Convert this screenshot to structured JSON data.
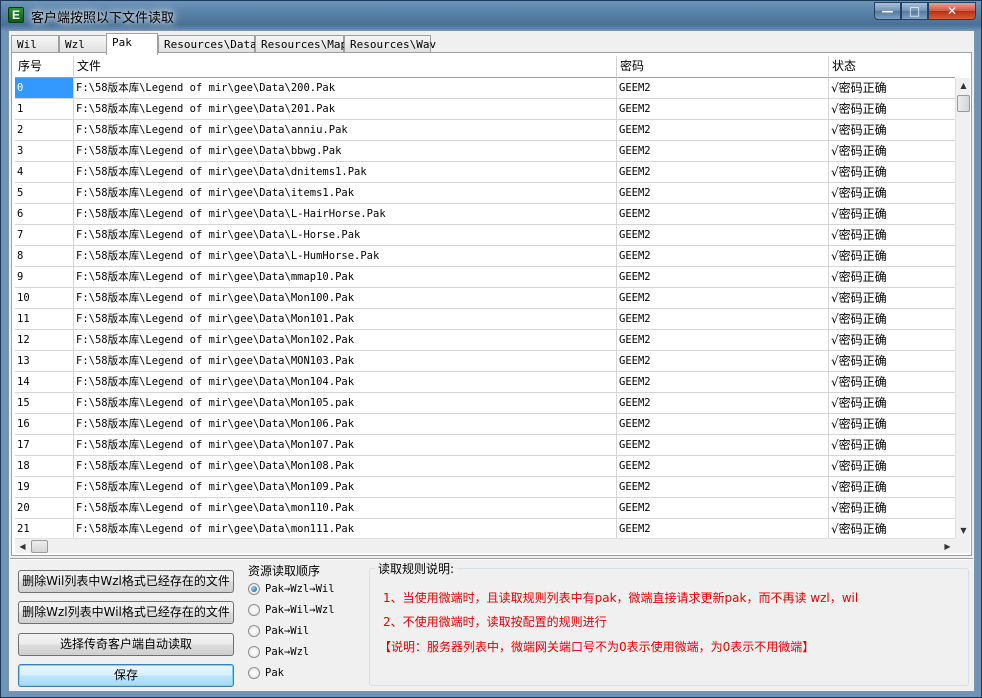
{
  "window": {
    "title": "客户端按照以下文件读取",
    "icon_letter": "E",
    "min": "—",
    "max": "□",
    "close": "✕"
  },
  "tabs": [
    {
      "label": "Wil",
      "active": false
    },
    {
      "label": "Wzl",
      "active": false
    },
    {
      "label": "Pak",
      "active": true
    },
    {
      "label": "Resources\\Data",
      "active": false
    },
    {
      "label": "Resources\\Map",
      "active": false
    },
    {
      "label": "Resources\\Wav",
      "active": false
    }
  ],
  "grid": {
    "columns": [
      "序号",
      "文件",
      "密码",
      "状态"
    ],
    "rows": [
      [
        "0",
        "F:\\58版本库\\Legend of mir\\gee\\Data\\200.Pak",
        "GEEM2",
        "√密码正确"
      ],
      [
        "1",
        "F:\\58版本库\\Legend of mir\\gee\\Data\\201.Pak",
        "GEEM2",
        "√密码正确"
      ],
      [
        "2",
        "F:\\58版本库\\Legend of mir\\gee\\Data\\anniu.Pak",
        "GEEM2",
        "√密码正确"
      ],
      [
        "3",
        "F:\\58版本库\\Legend of mir\\gee\\Data\\bbwg.Pak",
        "GEEM2",
        "√密码正确"
      ],
      [
        "4",
        "F:\\58版本库\\Legend of mir\\gee\\Data\\dnitems1.Pak",
        "GEEM2",
        "√密码正确"
      ],
      [
        "5",
        "F:\\58版本库\\Legend of mir\\gee\\Data\\items1.Pak",
        "GEEM2",
        "√密码正确"
      ],
      [
        "6",
        "F:\\58版本库\\Legend of mir\\gee\\Data\\L-HairHorse.Pak",
        "GEEM2",
        "√密码正确"
      ],
      [
        "7",
        "F:\\58版本库\\Legend of mir\\gee\\Data\\L-Horse.Pak",
        "GEEM2",
        "√密码正确"
      ],
      [
        "8",
        "F:\\58版本库\\Legend of mir\\gee\\Data\\L-HumHorse.Pak",
        "GEEM2",
        "√密码正确"
      ],
      [
        "9",
        "F:\\58版本库\\Legend of mir\\gee\\Data\\mmap10.Pak",
        "GEEM2",
        "√密码正确"
      ],
      [
        "10",
        "F:\\58版本库\\Legend of mir\\gee\\Data\\Mon100.Pak",
        "GEEM2",
        "√密码正确"
      ],
      [
        "11",
        "F:\\58版本库\\Legend of mir\\gee\\Data\\Mon101.Pak",
        "GEEM2",
        "√密码正确"
      ],
      [
        "12",
        "F:\\58版本库\\Legend of mir\\gee\\Data\\Mon102.Pak",
        "GEEM2",
        "√密码正确"
      ],
      [
        "13",
        "F:\\58版本库\\Legend of mir\\gee\\Data\\MON103.Pak",
        "GEEM2",
        "√密码正确"
      ],
      [
        "14",
        "F:\\58版本库\\Legend of mir\\gee\\Data\\Mon104.Pak",
        "GEEM2",
        "√密码正确"
      ],
      [
        "15",
        "F:\\58版本库\\Legend of mir\\gee\\Data\\Mon105.pak",
        "GEEM2",
        "√密码正确"
      ],
      [
        "16",
        "F:\\58版本库\\Legend of mir\\gee\\Data\\Mon106.Pak",
        "GEEM2",
        "√密码正确"
      ],
      [
        "17",
        "F:\\58版本库\\Legend of mir\\gee\\Data\\Mon107.Pak",
        "GEEM2",
        "√密码正确"
      ],
      [
        "18",
        "F:\\58版本库\\Legend of mir\\gee\\Data\\Mon108.Pak",
        "GEEM2",
        "√密码正确"
      ],
      [
        "19",
        "F:\\58版本库\\Legend of mir\\gee\\Data\\Mon109.Pak",
        "GEEM2",
        "√密码正确"
      ],
      [
        "20",
        "F:\\58版本库\\Legend of mir\\gee\\Data\\mon110.Pak",
        "GEEM2",
        "√密码正确"
      ],
      [
        "21",
        "F:\\58版本库\\Legend of mir\\gee\\Data\\mon111.Pak",
        "GEEM2",
        "√密码正确"
      ]
    ],
    "selected_row": 0
  },
  "actions": {
    "delete_wil": "删除Wil列表中Wzl格式已经存在的文件",
    "delete_wzl": "删除Wzl列表中Wil格式已经存在的文件",
    "auto_read": "选择传奇客户端自动读取",
    "save": "保存"
  },
  "order": {
    "title": "资源读取顺序",
    "options": [
      {
        "label": "Pak→Wzl→Wil",
        "checked": true
      },
      {
        "label": "Pak→Wil→Wzl",
        "checked": false
      },
      {
        "label": "Pak→Wil",
        "checked": false
      },
      {
        "label": "Pak→Wzl",
        "checked": false
      },
      {
        "label": "Pak",
        "checked": false
      }
    ]
  },
  "rules": {
    "title": "读取规则说明:",
    "line1": "1、当使用微端时，且读取规则列表中有pak，微端直接请求更新pak，而不再读 wzl，wil",
    "line2": "2、不使用微端时，读取按配置的规则进行",
    "line3": "【说明：服务器列表中，微端网关端口号不为0表示使用微端，为0表示不用微端】"
  },
  "icons": {
    "scroll_up": "▲",
    "scroll_down": "▼",
    "scroll_left": "◀",
    "scroll_right": "▶"
  }
}
